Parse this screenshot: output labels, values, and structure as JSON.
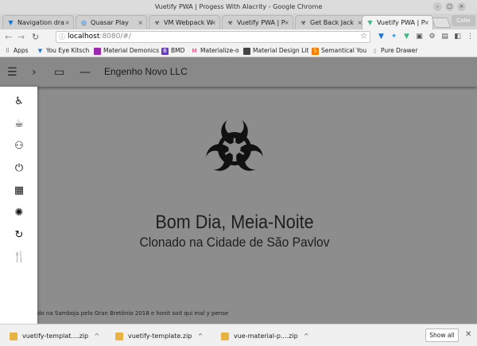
{
  "window": {
    "title": "Vuetify PWA | Progess With Alacrity - Google Chrome"
  },
  "tabs": [
    {
      "label": "Navigation dra",
      "icon": "vuetify-icon",
      "active": false
    },
    {
      "label": "Quasar Play",
      "icon": "quasar-icon",
      "active": false
    },
    {
      "label": "VM Webpack W",
      "icon": "biohazard-icon",
      "active": false
    },
    {
      "label": "Vuetify PWA | P",
      "icon": "biohazard-icon",
      "active": false
    },
    {
      "label": "Get Back Jack",
      "icon": "biohazard-icon",
      "active": false
    },
    {
      "label": "Vuetify PWA | P",
      "icon": "vue-icon",
      "active": true
    }
  ],
  "profile": {
    "label": "Colin"
  },
  "address_bar": {
    "host": "localhost",
    "path": ":8080/#/"
  },
  "bookmarks": [
    {
      "label": "Apps",
      "icon": "apps-grid-icon",
      "color": "#555555"
    },
    {
      "label": "You Eye Kitsch",
      "icon": "vuetify-icon",
      "color": "#1976d2"
    },
    {
      "label": "Material Demonics",
      "icon": "material-icon",
      "color": "#9c27b0"
    },
    {
      "label": "BMD",
      "icon": "bmd-icon",
      "color": "#673ab7"
    },
    {
      "label": "Materialize-o",
      "icon": "materialize-icon",
      "color": "#e91e63"
    },
    {
      "label": "Material Design Lit",
      "icon": "material-lite-icon",
      "color": "#444444"
    },
    {
      "label": "Semantical You",
      "icon": "semantic-icon",
      "color": "#f57c00"
    },
    {
      "label": "Pure Drawer",
      "icon": "page-icon",
      "color": "#888888"
    }
  ],
  "app": {
    "title": "Engenho Novo LLC",
    "heading": "Bom Dia, Meia-Noite",
    "subheading": "Clonado na Cidade de São Pavlov",
    "footer": "do na Samboja pelo Gran Bretônio 2018 e honit soit qui mal y pense"
  },
  "drawer_items": [
    {
      "name": "accessibility-icon",
      "glyph": "♿"
    },
    {
      "name": "coffee-icon",
      "glyph": "☕"
    },
    {
      "name": "bike-icon",
      "glyph": "⚇"
    },
    {
      "name": "power-icon",
      "glyph": "⏻"
    },
    {
      "name": "business-icon",
      "glyph": "▦"
    },
    {
      "name": "camera-iris-icon",
      "glyph": "✺"
    },
    {
      "name": "rotate-360-icon",
      "glyph": "↻"
    },
    {
      "name": "restaurant-icon",
      "glyph": "🍴"
    }
  ],
  "downloads": {
    "items": [
      "vuetify-templat....zip",
      "vuetify-template.zip",
      "vue-material-p....zip"
    ],
    "show_all": "Show all"
  },
  "colors": {
    "page_background": "#8d8d8d",
    "app_bar": "#898989",
    "download_icon": "#e8b341"
  }
}
